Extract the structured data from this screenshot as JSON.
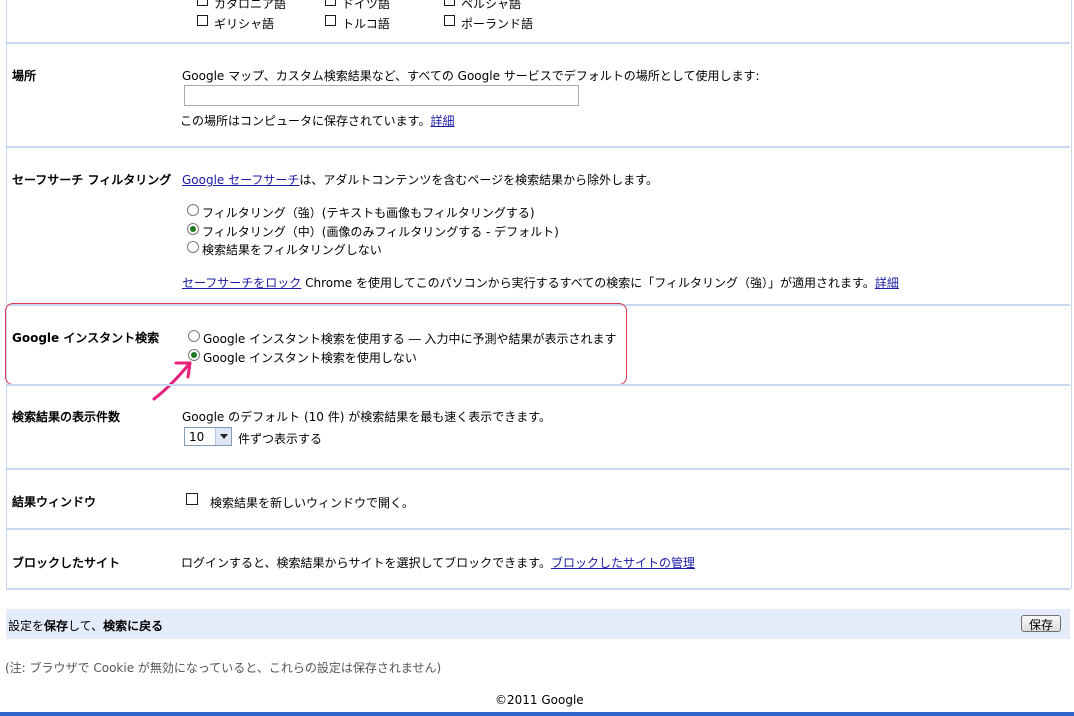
{
  "languages": {
    "row1": [
      "カタロニア語",
      "ドイツ語",
      "ペルシャ語"
    ],
    "row2": [
      "ギリシャ語",
      "トルコ語",
      "ポーランド語"
    ]
  },
  "location": {
    "label": "場所",
    "description": "Google マップ、カスタム検索結果など、すべての Google サービスでデフォルトの場所として使用します:",
    "input_value": "",
    "note": "この場所はコンピュータに保存されています。",
    "details_link": "詳細"
  },
  "safesearch": {
    "label": "セーフサーチ フィルタリング",
    "link": "Google セーフサーチ",
    "description": "は、アダルトコンテンツを含むページを検索結果から除外します。",
    "options": [
      {
        "label": "フィルタリング（強）(テキストも画像もフィルタリングする)",
        "checked": false
      },
      {
        "label": "フィルタリング（中）(画像のみフィルタリングする - デフォルト)",
        "checked": true
      },
      {
        "label": "検索結果をフィルタリングしない",
        "checked": false
      }
    ],
    "lock_link": "セーフサーチをロック",
    "lock_text": " Chrome を使用してこのパソコンから実行するすべての検索に「フィルタリング（強）」が適用されます。",
    "details_link": "詳細"
  },
  "instant": {
    "label": "Google インスタント検索",
    "options": [
      {
        "label": "Google インスタント検索を使用する ― 入力中に予測や結果が表示されます",
        "checked": false
      },
      {
        "label": "Google インスタント検索を使用しない",
        "checked": true
      }
    ],
    "annotation_color": "#e8207a"
  },
  "results_count": {
    "label": "検索結果の表示件数",
    "description": "Google のデフォルト (10 件) が検索結果を最も速く表示できます。",
    "selected": "10",
    "suffix": "件ずつ表示する"
  },
  "results_window": {
    "label": "結果ウィンドウ",
    "checkbox_label": "検索結果を新しいウィンドウで開く。",
    "checked": false
  },
  "blocked_sites": {
    "label": "ブロックしたサイト",
    "text": "ログインすると、検索結果からサイトを選択してブロックできます。",
    "link": "ブロックしたサイトの管理"
  },
  "save_bar": {
    "text_prefix": "設定を",
    "text_bold1": "保存",
    "text_mid": "して、",
    "text_bold2": "検索に戻る",
    "button": "保存"
  },
  "footer": {
    "note": "(注: ブラウザで Cookie が無効になっていると、これらの設定は保存されません)",
    "copyright": "©2011 Google"
  }
}
